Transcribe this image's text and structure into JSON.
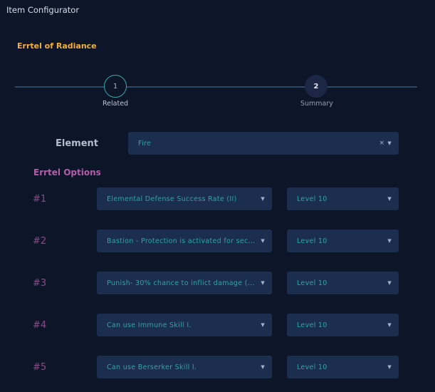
{
  "window": {
    "title": "Item Configurator"
  },
  "item": {
    "name": "Errtel of Radiance"
  },
  "stepper": {
    "steps": [
      {
        "number": "1",
        "label": "Related"
      },
      {
        "number": "2",
        "label": "Summary"
      }
    ]
  },
  "element": {
    "label": "Element",
    "value": "Fire",
    "clear_icon": "×"
  },
  "options": {
    "title": "Errtel Options",
    "rows": [
      {
        "num": "#1",
        "option": "Elemental Defense Success Rate (II)",
        "level": "Level 10"
      },
      {
        "num": "#2",
        "option": "Bastion - Protection is activated for sec...",
        "level": "Level 10"
      },
      {
        "num": "#3",
        "option": "Punish- 30% chance to inflict damage (...",
        "level": "Level 10"
      },
      {
        "num": "#4",
        "option": "Can use Immune Skill I.",
        "level": "Level 10"
      },
      {
        "num": "#5",
        "option": "Can use Berserker Skill I.",
        "level": "Level 10"
      }
    ]
  },
  "colors": {
    "background": "#0d1628",
    "accent_orange": "#f0b13c",
    "accent_purple": "#b05fa8",
    "select_bg": "#1c2e4e",
    "select_text": "#2fa3a6"
  }
}
